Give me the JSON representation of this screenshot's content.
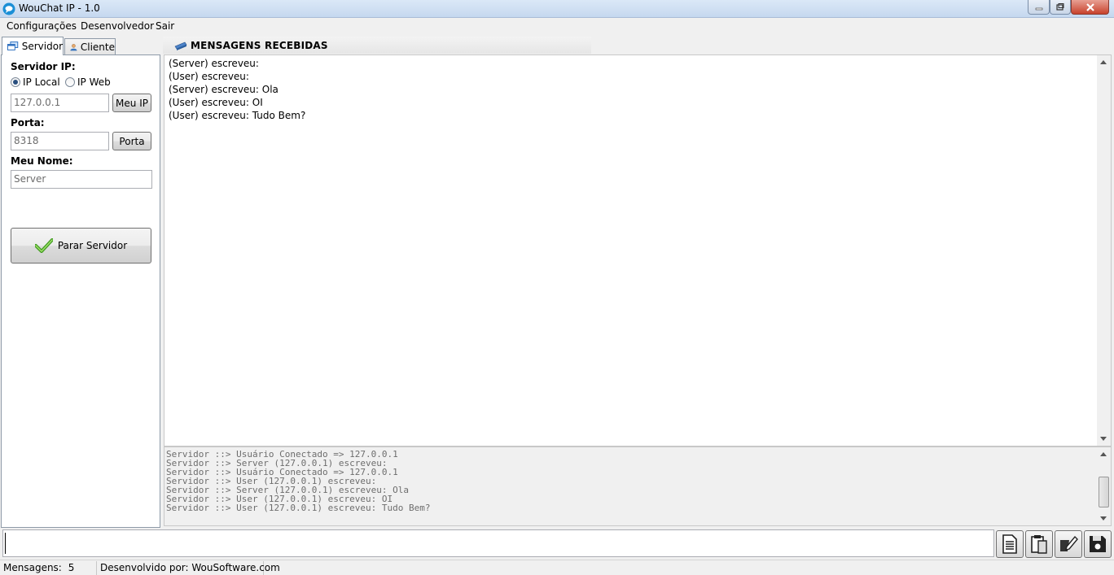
{
  "window": {
    "title": "WouChat IP - 1.0",
    "icon": "chat-bubble-icon",
    "controls": [
      "minimize",
      "maximize",
      "close"
    ]
  },
  "menu": [
    "Configurações",
    "Desenvolvedor",
    "Sair"
  ],
  "tabs": [
    {
      "label": "Servidor",
      "icon": "windows-icon",
      "active": true
    },
    {
      "label": "Cliente",
      "icon": "user-icon",
      "active": false
    }
  ],
  "server_form": {
    "ip_label": "Servidor IP:",
    "radio_local": "IP Local",
    "radio_web": "IP Web",
    "selected_radio": "IP Local",
    "ip_value": "127.0.0.1",
    "my_ip_button": "Meu IP",
    "port_label": "Porta:",
    "port_value": "8318",
    "port_button": "Porta",
    "name_label": "Meu Nome:",
    "name_value": "Server",
    "stop_button": "Parar Servidor",
    "stop_icon": "checkmark-icon"
  },
  "messages_panel": {
    "header": "MENSAGENS RECEBIDAS",
    "header_icon": "messages-icon",
    "lines": [
      "(Server) escreveu:",
      "(User) escreveu:",
      "(Server) escreveu: Ola",
      "(User) escreveu: OI",
      "(User) escreveu: Tudo Bem?"
    ]
  },
  "log": {
    "lines": [
      "Servidor ::> Usuário Conectado => 127.0.0.1",
      "Servidor ::> Server (127.0.0.1) escreveu:",
      "Servidor ::> Usuário Conectado => 127.0.0.1",
      "Servidor ::> User (127.0.0.1) escreveu:",
      "Servidor ::> Server (127.0.0.1) escreveu: Ola",
      "Servidor ::> User (127.0.0.1) escreveu: OI",
      "Servidor ::> User (127.0.0.1) escreveu: Tudo Bem?"
    ]
  },
  "input": {
    "value": ""
  },
  "toolbar_icons": [
    "document-icon",
    "clipboard-icon",
    "edit-icon",
    "save-icon"
  ],
  "status": {
    "messages_label": "Mensagens:",
    "messages_count": "5",
    "developer": "Desenvolvido por: WouSoftware.com"
  },
  "colors": {
    "titlebar": "#c5d8ef",
    "close_button": "#c7422c",
    "radio_selected": "#2a4f7f"
  }
}
